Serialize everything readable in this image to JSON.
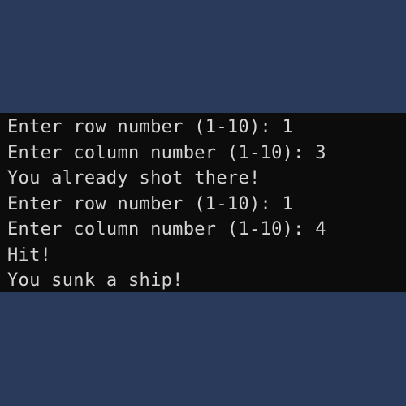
{
  "terminal": {
    "lines": [
      "Enter row number (1-10): 1",
      "Enter column number (1-10): 3",
      "You already shot there!",
      "Enter row number (1-10): 1",
      "Enter column number (1-10): 4",
      "Hit!",
      "You sunk a ship!"
    ]
  },
  "colors": {
    "background": "#293a5a",
    "terminal_background": "#0c0c0c",
    "text": "#d4d4d4"
  }
}
